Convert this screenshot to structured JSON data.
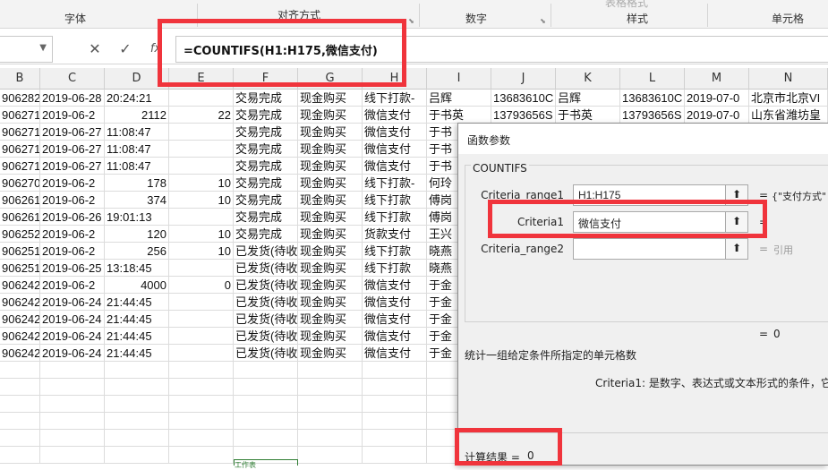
{
  "ribbon": {
    "groups": [
      {
        "label": "字体"
      },
      {
        "label": "对齐方式"
      },
      {
        "label": "数字"
      },
      {
        "label": "样式"
      },
      {
        "label": "单元格"
      }
    ],
    "partial_top_label": "表格格式"
  },
  "formula_bar": {
    "cancel_glyph": "✕",
    "enter_glyph": "✓",
    "fx_glyph": "fx",
    "formula": "=COUNTIFS(H1:H175,微信支付)"
  },
  "columns": [
    "B",
    "C",
    "D",
    "E",
    "F",
    "G",
    "H",
    "I",
    "J",
    "K",
    "L",
    "M",
    "N"
  ],
  "rows": [
    [
      "906282",
      "2019-06-28",
      "20:24:21",
      "",
      "交易完成",
      "现金购买",
      "线下打款-",
      "吕辉",
      "13683610C",
      "吕辉",
      "13683610C",
      "2019-07-0",
      "北京市北京VI"
    ],
    [
      "906271",
      "2019-06-2",
      "2112",
      "22",
      "交易完成",
      "现金购买",
      "微信支付",
      "于书英",
      "13793656S",
      "于书英",
      "13793656S",
      "2019-07-0",
      "山东省潍坊皇"
    ],
    [
      "906271",
      "2019-06-27",
      "11:08:47",
      "",
      "交易完成",
      "现金购买",
      "微信支付",
      "于书",
      "",
      "",
      "",
      "",
      ""
    ],
    [
      "906271",
      "2019-06-27",
      "11:08:47",
      "",
      "交易完成",
      "现金购买",
      "微信支付",
      "于书",
      "",
      "",
      "",
      "",
      ""
    ],
    [
      "906271",
      "2019-06-27",
      "11:08:47",
      "",
      "交易完成",
      "现金购买",
      "微信支付",
      "于书",
      "",
      "",
      "",
      "",
      ""
    ],
    [
      "906270",
      "2019-06-2",
      "178",
      "10",
      "交易完成",
      "现金购买",
      "线下打款-",
      "何玲",
      "",
      "",
      "",
      "",
      ""
    ],
    [
      "906261",
      "2019-06-2",
      "374",
      "10",
      "交易完成",
      "现金购买",
      "线下打款",
      "傅岗",
      "",
      "",
      "",
      "",
      ""
    ],
    [
      "906261",
      "2019-06-26",
      "19:01:13",
      "",
      "交易完成",
      "现金购买",
      "线下打款",
      "傅岗",
      "",
      "",
      "",
      "",
      ""
    ],
    [
      "906252",
      "2019-06-2",
      "120",
      "10",
      "交易完成",
      "现金购买",
      "货款支付",
      "王兴",
      "",
      "",
      "",
      "",
      ""
    ],
    [
      "906251",
      "2019-06-2",
      "256",
      "10",
      "已发货(待收",
      "现金购买",
      "线下打款",
      "晓燕",
      "",
      "",
      "",
      "",
      ""
    ],
    [
      "906251",
      "2019-06-25",
      "13:18:45",
      "",
      "已发货(待收",
      "现金购买",
      "线下打款",
      "晓燕",
      "",
      "",
      "",
      "",
      ""
    ],
    [
      "906242",
      "2019-06-2",
      "4000",
      "0",
      "已发货(待收",
      "现金购买",
      "微信支付",
      "于金",
      "",
      "",
      "",
      "",
      ""
    ],
    [
      "906242",
      "2019-06-24",
      "21:44:45",
      "",
      "已发货(待收",
      "现金购买",
      "微信支付",
      "于金",
      "",
      "",
      "",
      "",
      ""
    ],
    [
      "906242",
      "2019-06-24",
      "21:44:45",
      "",
      "已发货(待收",
      "现金购买",
      "微信支付",
      "于金",
      "",
      "",
      "",
      "",
      ""
    ],
    [
      "906242",
      "2019-06-24",
      "21:44:45",
      "",
      "已发货(待收",
      "现金购买",
      "微信支付",
      "于金",
      "",
      "",
      "",
      "",
      ""
    ],
    [
      "906242",
      "2019-06-24",
      "21:44:45",
      "",
      "已发货(待收",
      "现金购买",
      "微信支付",
      "于金",
      "",
      "",
      "",
      "",
      ""
    ]
  ],
  "sheet_tab_partial": "工作表",
  "dialog": {
    "title": "函数参数",
    "function_name": "COUNTIFS",
    "args": [
      {
        "label": "Criteria_range1",
        "value": "H1:H175",
        "eq": "=",
        "result": "{\"支付方式\""
      },
      {
        "label": "Criteria1",
        "value": "微信支付",
        "eq": "=",
        "result": ""
      },
      {
        "label": "Criteria_range2",
        "value": "",
        "eq": "=",
        "result": "引用"
      }
    ],
    "collapse_glyph": "⬆",
    "overall_eq": "=",
    "overall_value": "0",
    "description": "统计一组给定条件所指定的单元格数",
    "arg_help": "Criteria1:  是数字、表达式或文本形式的条件，它",
    "calc_result_label": "计算结果 =",
    "calc_result_value": "0"
  },
  "colors": {
    "highlight_red": "#f0343c",
    "ribbon_bg": "#f3f3f3",
    "dialog_bg": "#f0f0f0"
  }
}
